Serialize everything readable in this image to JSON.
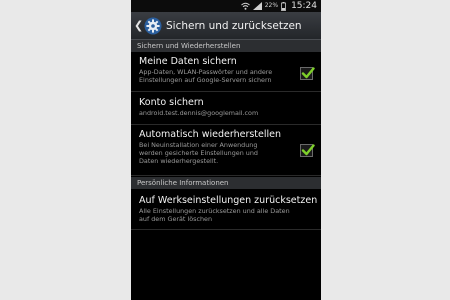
{
  "status_bar": {
    "battery_percent": "22%",
    "time": "15:24",
    "icons": [
      "signal-icon",
      "wifi-icon",
      "battery-icon"
    ]
  },
  "action_bar": {
    "title": "Sichern und zurücksetzen",
    "icon": "settings-gear-icon"
  },
  "sections": [
    {
      "header": "Sichern und Wiederherstellen",
      "items": [
        {
          "title": "Meine Daten sichern",
          "summary": "App-Daten, WLAN-Passwörter und andere\nEinstellungen auf Google-Servern sichern",
          "checked": true
        },
        {
          "title": "Konto sichern",
          "summary": "android.test.dennis@googlemail.com"
        },
        {
          "title": "Automatisch wiederherstellen",
          "summary": "Bei Neuinstallation einer Anwendung\nwerden gesicherte Einstellungen und\nDaten wiederhergestellt.",
          "checked": true
        }
      ]
    },
    {
      "header": "Persönliche Informationen",
      "items": [
        {
          "title": "Auf Werkseinstellungen zurücksetzen",
          "summary": "Alle Einstellungen zurücksetzen und alle Daten\nauf dem Gerät löschen"
        }
      ]
    }
  ],
  "colors": {
    "accent_check": "#7ecf2a",
    "background": "#000000",
    "section_header_bg": "#2c2e31"
  }
}
